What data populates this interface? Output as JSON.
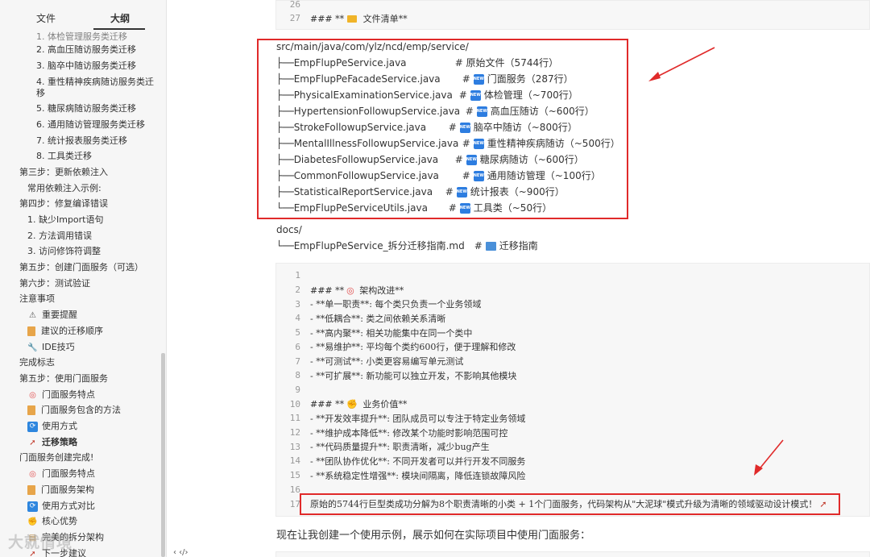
{
  "sidebar": {
    "tabs": {
      "files": "文件",
      "outline": "大纲"
    },
    "items": [
      "1. 体检管理服务类迁移",
      "2. 高血压随访服务类迁移",
      "3. 脑卒中随访服务类迁移",
      "4. 重性精神疾病随访服务类迁移",
      "5. 糖尿病随访服务类迁移",
      "6. 通用随访管理服务类迁移",
      "7. 统计报表服务类迁移",
      "8. 工具类迁移",
      "第三步：更新依赖注入",
      "常用依赖注入示例:",
      "第四步：修复编译错误",
      "1. 缺少Import语句",
      "2. 方法调用错误",
      "3. 访问修饰符调整",
      "第五步：创建门面服务（可选）",
      "第六步：测试验证",
      "注意事项",
      "重要提醒",
      "建议的迁移顺序",
      "IDE技巧",
      "完成标志",
      "第五步：使用门面服务",
      "门面服务特点",
      "门面服务包含的方法",
      "使用方式",
      "迁移策略",
      "门面服务创建完成!",
      "门面服务特点",
      "门面服务架构",
      "使用方式对比",
      "核心优势",
      "完美的拆分架构",
      "下一步建议"
    ],
    "icons": [
      "warning-icon",
      "clipboard-icon",
      "wrench-icon",
      "target-icon",
      "clipboard-icon",
      "sync-icon",
      "rocket-icon",
      "target-icon",
      "clipboard-icon",
      "sync-icon",
      "muscle-icon",
      "rocket-icon"
    ],
    "bottom_icons": "‹  ‹/›",
    "watermark": "大就情境"
  },
  "code_top": {
    "lines": [
      {
        "num": "26",
        "text": ""
      },
      {
        "num": "27",
        "text": "### **  文件清单**"
      }
    ]
  },
  "tree": {
    "root": "src/main/java/com/ylz/ncd/emp/service/",
    "rows": [
      {
        "prefix": "├── ",
        "name": "EmpFlupPeService.java",
        "comment": "# 原始文件（5744行）",
        "badge": false
      },
      {
        "prefix": "├── ",
        "name": "EmpFlupPeFacadeService.java",
        "comment": "门面服务（287行）",
        "badge": true
      },
      {
        "prefix": "├── ",
        "name": "PhysicalExaminationService.java",
        "comment": "体检管理（~700行）",
        "badge": true
      },
      {
        "prefix": "├── ",
        "name": "HypertensionFollowupService.java",
        "comment": "高血压随访（~600行）",
        "badge": true
      },
      {
        "prefix": "├── ",
        "name": "StrokeFollowupService.java",
        "comment": "脑卒中随访（~800行）",
        "badge": true
      },
      {
        "prefix": "├── ",
        "name": "MentalIllnessFollowupService.java",
        "comment": "重性精神疾病随访（~500行）",
        "badge": true
      },
      {
        "prefix": "├── ",
        "name": "DiabetesFollowupService.java",
        "comment": "糖尿病随访（~600行）",
        "badge": true
      },
      {
        "prefix": "├── ",
        "name": "CommonFollowupService.java",
        "comment": "通用随访管理（~100行）",
        "badge": true
      },
      {
        "prefix": "├── ",
        "name": "StatisticalReportService.java",
        "comment": "统计报表（~900行）",
        "badge": true
      },
      {
        "prefix": "└── ",
        "name": "EmpFlupPeServiceUtils.java",
        "comment": "工具类（~50行）",
        "badge": true
      }
    ],
    "docs_root": "docs/",
    "docs_row": {
      "prefix": "└── ",
      "name": "EmpFlupPeService_拆分迁移指南.md",
      "comment": "迁移指南"
    }
  },
  "code_main": {
    "lines": [
      {
        "num": "1",
        "text": ""
      },
      {
        "num": "2",
        "text": ""
      },
      {
        "num": "3",
        "text": "### **  架构改进**",
        "icon": "target"
      },
      {
        "num": "3",
        "text": "- **单一职责**: 每个类只负责一个业务领域"
      },
      {
        "num": "4",
        "text": "- **低耦合**: 类之间依赖关系清晰"
      },
      {
        "num": "5",
        "text": "- **高内聚**: 相关功能集中在同一个类中"
      },
      {
        "num": "6",
        "text": "- **易维护**: 平均每个类约600行，便于理解和修改"
      },
      {
        "num": "7",
        "text": "- **可测试**: 小类更容易编写单元测试"
      },
      {
        "num": "8",
        "text": "- **可扩展**: 新功能可以独立开发，不影响其他模块"
      },
      {
        "num": "9",
        "text": ""
      },
      {
        "num": "10",
        "text": "### **  业务价值**",
        "icon": "muscle"
      },
      {
        "num": "11",
        "text": "- **开发效率提升**: 团队成员可以专注于特定业务领域"
      },
      {
        "num": "12",
        "text": "- **维护成本降低**: 修改某个功能时影响范围可控"
      },
      {
        "num": "13",
        "text": "- **代码质量提升**: 职责清晰，减少bug产生"
      },
      {
        "num": "14",
        "text": "- **团队协作优化**: 不同开发者可以并行开发不同服务"
      },
      {
        "num": "15",
        "text": "- **系统稳定性增强**: 模块间隔离，降低连锁故障风险"
      },
      {
        "num": "16",
        "text": ""
      },
      {
        "num": "17",
        "text": "原始的5744行巨型类成功分解为8个职责清晰的小类 + 1个门面服务，代码架构从\"大泥球\"模式升级为清晰的领域驱动设计模式！",
        "icon": "rocket"
      }
    ]
  },
  "paragraph": "现在让我创建一个使用示例，展示如何在实际项目中使用门面服务：",
  "colors": {
    "highlight": "#e02a2a",
    "badge": "#2d7de0",
    "code_bg": "#f7f7f7"
  }
}
